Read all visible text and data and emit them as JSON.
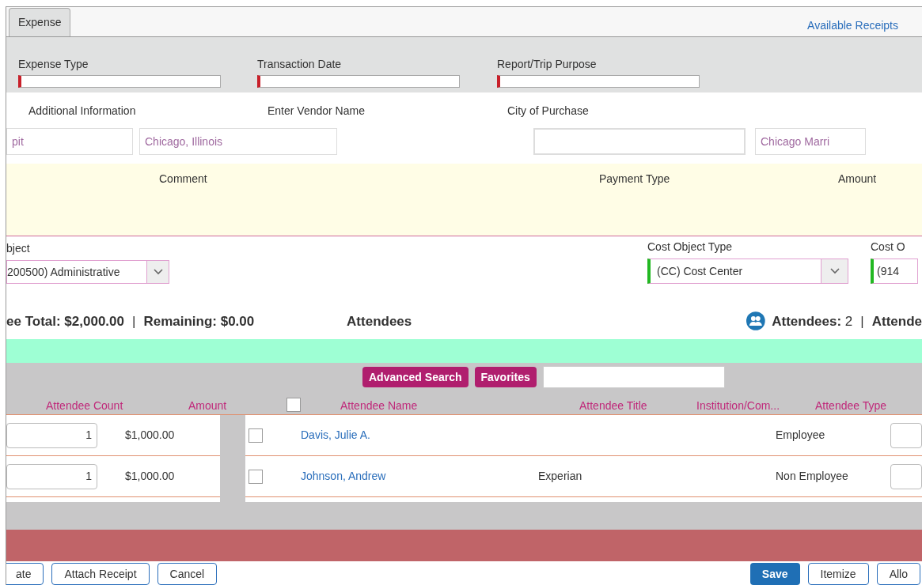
{
  "tabs": [
    {
      "label": "Expense",
      "selected": true
    }
  ],
  "available_receipts": "Available Receipts",
  "header_fields": [
    {
      "label": "Expense Type"
    },
    {
      "label": "Transaction Date"
    },
    {
      "label": "Report/Trip Purpose"
    }
  ],
  "info_labels": [
    "Additional Information",
    "Enter Vendor Name",
    "City of Purchase"
  ],
  "info_fields": [
    {
      "value": "pit"
    },
    {
      "value": "Chicago, Illinois"
    },
    {
      "focused": true
    },
    {
      "value": "Chicago Marri"
    }
  ],
  "comment_label": "Comment",
  "payment_type_label": "Payment Type",
  "amount_label": "Amount",
  "cost_object": {
    "label": "bject",
    "value": "200500) Administrative"
  },
  "cost_object_type": {
    "label": "Cost Object Type",
    "value": "(CC) Cost Center"
  },
  "cost_object_2": {
    "label": "Cost O",
    "value": "(914"
  },
  "totals": "ee Total: $2,000.00",
  "totals_separator": "|",
  "remaining": "Remaining: $0.00",
  "attendees_heading": "Attendees",
  "attendees_count": {
    "label": "Attendees:",
    "value": "2",
    "separator": "|",
    "extra": "Attende"
  },
  "toolbar_buttons": [
    "Advanced Search",
    "Favorites"
  ],
  "select_all_checked": false,
  "allocation_columns": [
    "Attendee Count",
    "Amount"
  ],
  "allocation_rows": [
    {
      "count": "1",
      "amount": "$1,000.00"
    },
    {
      "count": "1",
      "amount": "$1,000.00"
    }
  ],
  "attendee_columns": [
    "Attendee Name",
    "Attendee Title",
    "Institution/Com...",
    "Attendee Type"
  ],
  "attendee_rows": [
    {
      "checked": false,
      "name": "Davis, Julie A.",
      "type": "Employee"
    },
    {
      "checked": false,
      "name": "Johnson, Andrew",
      "title": "Experian",
      "type": "Non Employee"
    }
  ],
  "footer_left_buttons": [
    "ate",
    "Attach Receipt",
    "Cancel"
  ],
  "footer_right_buttons": [
    {
      "label": "Save",
      "primary": true
    },
    {
      "label": "Itemize",
      "primary": false
    },
    {
      "label": "Allo",
      "primary": false
    }
  ]
}
